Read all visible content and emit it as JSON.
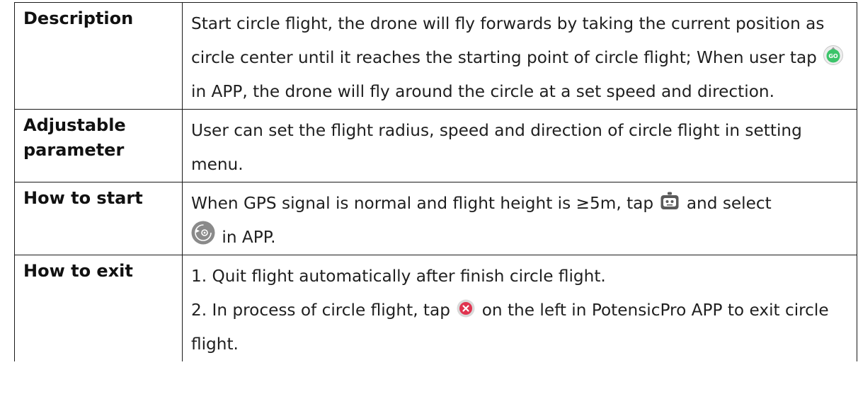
{
  "table": {
    "rows": [
      {
        "header": "Description",
        "body": {
          "part1": "Start circle flight, the drone will fly forwards by taking the current position as circle center until it reaches the starting point of circle flight; When user tap",
          "go_icon_text": "GO",
          "part2": "in APP, the drone will fly around the circle at a set speed and direction."
        }
      },
      {
        "header_line1": "Adjustable",
        "header_line2": "parameter",
        "body": "User can set the flight radius, speed and direction of circle flight in setting menu."
      },
      {
        "header": "How to start",
        "body": {
          "part1": "When GPS signal is normal and flight height is ≥5m, tap",
          "part2": "and select",
          "part3": "in APP."
        }
      },
      {
        "header": "How to exit",
        "body": {
          "line1": "1. Quit flight automatically after finish circle flight.",
          "line2_part1": "2. In process of circle flight, tap",
          "line2_part2": "on the left in PotensicPro APP to exit circle flight."
        }
      }
    ]
  },
  "icons": {
    "go_icon": {
      "name": "go-button-icon",
      "color": "#3cc46a"
    },
    "robot_icon": {
      "name": "robot-icon",
      "color": "#5a5a5a"
    },
    "circle_flight_icon": {
      "name": "circle-flight-icon",
      "color": "#8a8a8a"
    },
    "close_icon": {
      "name": "close-circle-icon",
      "color": "#e0334f"
    }
  }
}
